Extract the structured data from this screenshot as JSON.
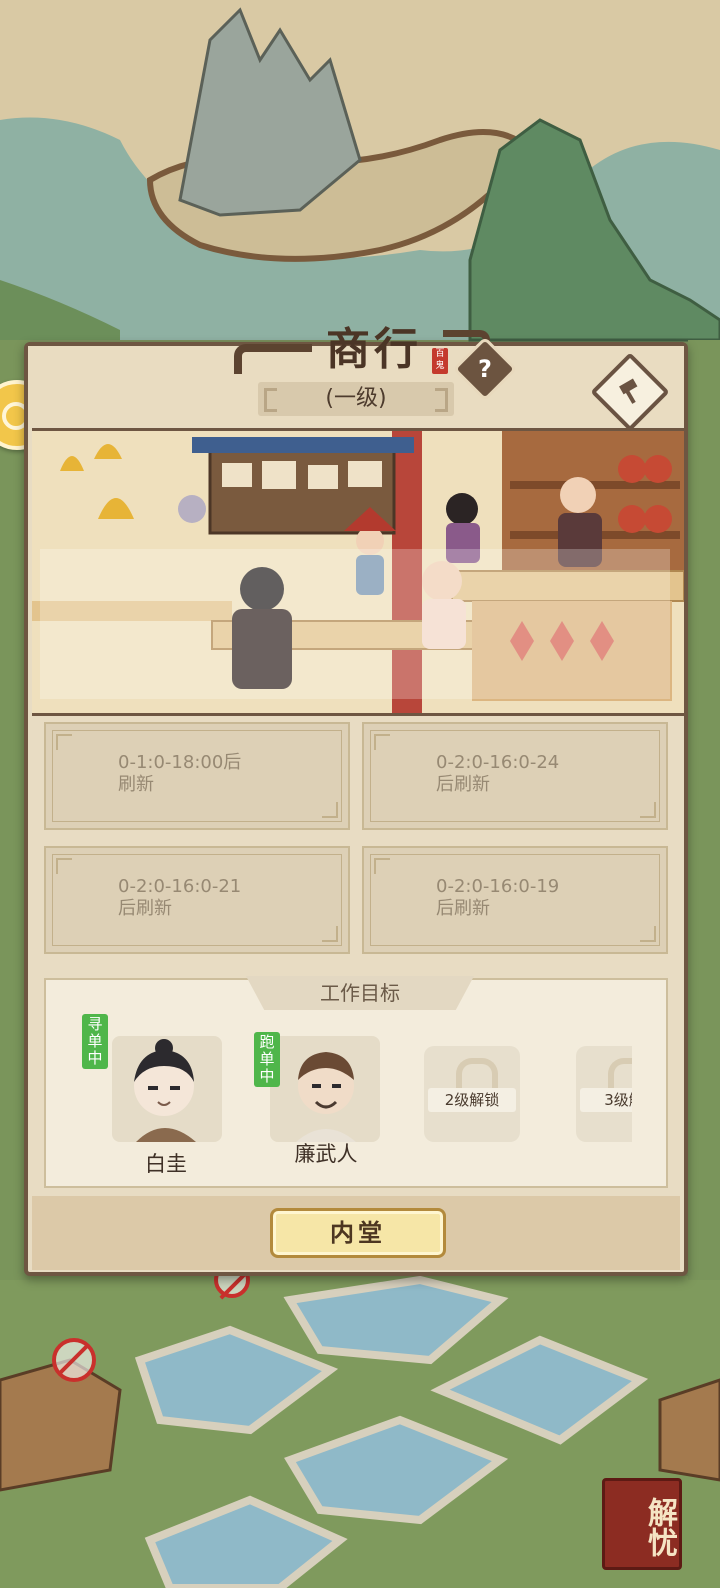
{
  "panel": {
    "title": "商行",
    "seal_text": "百鬼",
    "level": "(一级)",
    "help_icon": "?"
  },
  "orders": [
    {
      "text_line1": "0-1:0-18:00后",
      "text_line2": "刷新"
    },
    {
      "text_line1": "0-2:0-16:0-24",
      "text_line2": "后刷新"
    },
    {
      "text_line1": "0-2:0-16:0-21",
      "text_line2": "后刷新"
    },
    {
      "text_line1": "0-2:0-16:0-19",
      "text_line2": "后刷新"
    }
  ],
  "goals": {
    "title": "工作目标",
    "workers": [
      {
        "name": "白圭",
        "status": "寻单中"
      },
      {
        "name": "廉武人",
        "status": "跑单中"
      }
    ],
    "locked_slots": [
      {
        "label": "2级解锁"
      },
      {
        "label": "3级解"
      }
    ]
  },
  "bottom_button": "内堂",
  "corner_badge": "解忧",
  "colors": {
    "panel_bg": "#e8dcc3",
    "panel_border": "#6e5642",
    "status_tag_green": "#4fb64a",
    "button_gold": "#f6e6a7"
  }
}
